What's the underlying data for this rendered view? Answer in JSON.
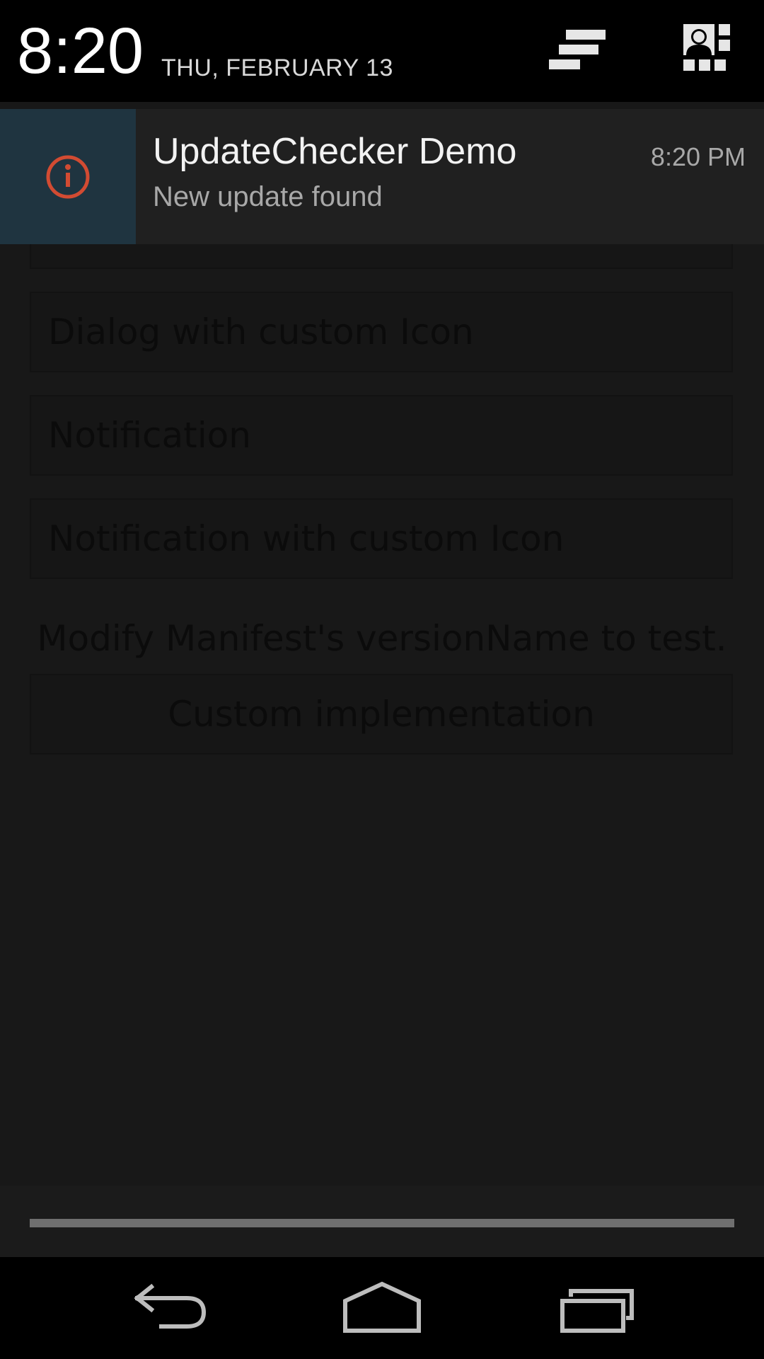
{
  "status_header": {
    "time": "8:20",
    "date": "THU, FEBRUARY 13",
    "clear_icon": "clear-all-icon",
    "quick_settings_icon": "quick-settings-icon"
  },
  "notification": {
    "app_name": "UpdateChecker Demo",
    "text": "New update found",
    "time": "8:20 PM",
    "icon": "info-icon",
    "icon_color": "#d24b32",
    "icon_bg": "#1f3440"
  },
  "background_app": {
    "buttons": [
      "Dialog with custom Icon",
      "Notification",
      "Notification with custom Icon"
    ],
    "hint": "Modify Manifest's versionName to test.",
    "custom_button": "Custom implementation"
  },
  "navbar": {
    "back_icon": "back-icon",
    "home_icon": "home-icon",
    "recents_icon": "recents-icon"
  }
}
